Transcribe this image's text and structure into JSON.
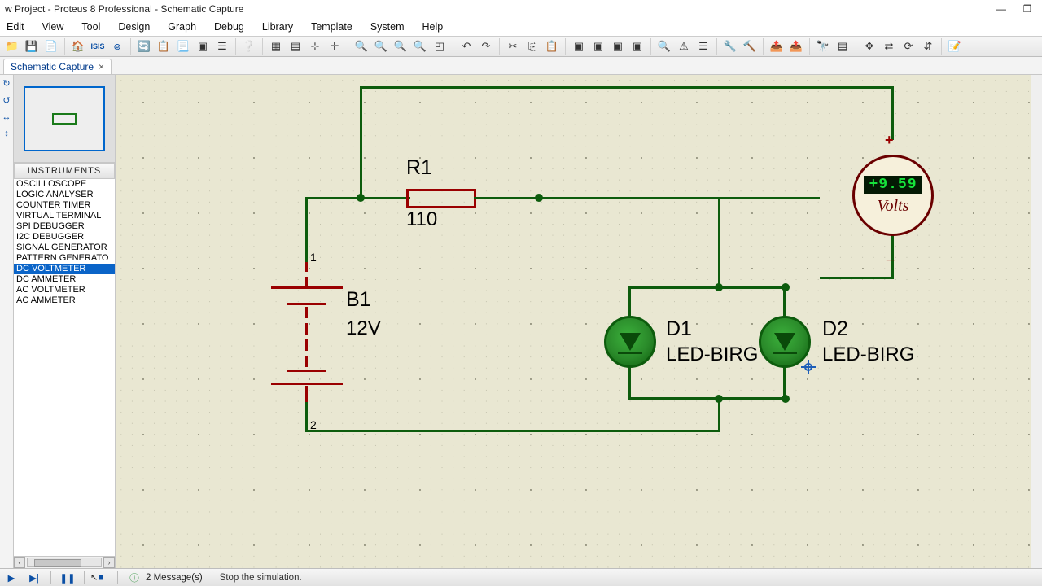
{
  "title": "w Project - Proteus 8 Professional - Schematic Capture",
  "menu": [
    "Edit",
    "View",
    "Tool",
    "Design",
    "Graph",
    "Debug",
    "Library",
    "Template",
    "System",
    "Help"
  ],
  "tab": {
    "label": "Schematic Capture",
    "close": "×"
  },
  "sidebar": {
    "header": "INSTRUMENTS",
    "items": [
      "OSCILLOSCOPE",
      "LOGIC ANALYSER",
      "COUNTER TIMER",
      "VIRTUAL TERMINAL",
      "SPI DEBUGGER",
      "I2C DEBUGGER",
      "SIGNAL GENERATOR",
      "PATTERN GENERATO",
      "DC VOLTMETER",
      "DC AMMETER",
      "AC VOLTMETER",
      "AC AMMETER"
    ],
    "selected": 8
  },
  "schematic": {
    "r1": {
      "ref": "R1",
      "val": "110"
    },
    "b1": {
      "ref": "B1",
      "val": "12V",
      "pin1": "1",
      "pin2": "2"
    },
    "d1": {
      "ref": "D1",
      "val": "LED-BIRG"
    },
    "d2": {
      "ref": "D2",
      "val": "LED-BIRG"
    },
    "voltmeter": {
      "reading": "+9.59",
      "unit": "Volts",
      "plus": "+",
      "minus": "_"
    }
  },
  "status": {
    "messages": "2 Message(s)",
    "hint": "Stop the simulation."
  },
  "winbtns": {
    "min": "—",
    "max": "❐"
  }
}
